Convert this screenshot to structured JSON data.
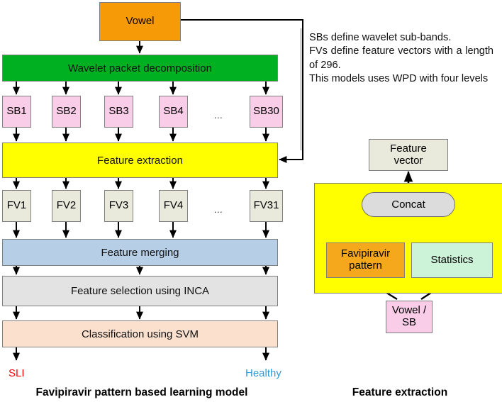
{
  "left_model": {
    "caption": "Favipiravir pattern based learning model",
    "input": {
      "label": "Vowel"
    },
    "wpd": {
      "label": "Wavelet packet decomposition"
    },
    "subbands": [
      {
        "label": "SB1"
      },
      {
        "label": "SB2"
      },
      {
        "label": "SB3"
      },
      {
        "label": "SB4"
      },
      {
        "label": "SB30"
      }
    ],
    "subband_ellipsis": "...",
    "feature_extraction": {
      "label": "Feature extraction"
    },
    "feature_vectors": [
      {
        "label": "FV1"
      },
      {
        "label": "FV2"
      },
      {
        "label": "FV3"
      },
      {
        "label": "FV4"
      },
      {
        "label": "FV31"
      }
    ],
    "fv_ellipsis": "...",
    "feature_merging": {
      "label": "Feature merging"
    },
    "feature_selection": {
      "label": "Feature selection using INCA"
    },
    "classification": {
      "label": "Classification using SVM"
    },
    "outputs": [
      {
        "label": "SLI",
        "color": "#FF0000"
      },
      {
        "label": "Healthy",
        "color": "#2E9BD6"
      }
    ]
  },
  "notes": {
    "lines": [
      "SBs define wavelet sub-bands.",
      "FVs define feature vectors with a length of 296.",
      "This models uses WPD with four levels"
    ]
  },
  "right_model": {
    "caption": "Feature extraction",
    "feature_vector": {
      "label": "Feature vector"
    },
    "concat": {
      "label": "Concat"
    },
    "favipiravir_pattern": {
      "label": "Favipiravir pattern"
    },
    "statistics": {
      "label": "Statistics"
    },
    "source": {
      "label": "Vowel / SB"
    }
  },
  "colors": {
    "orange": "#F79A08",
    "green": "#00B020",
    "pink": "#F9CCE8",
    "yellow": "#FFFF00",
    "beige": "#EAEADC",
    "blue": "#B6CFE6",
    "gray": "#E3E3E3",
    "peach": "#FBE0CE",
    "amber": "#F5A81C",
    "mint": "#CCF2D8",
    "concat_gray": "#DCDCDC",
    "line": "#000000"
  }
}
